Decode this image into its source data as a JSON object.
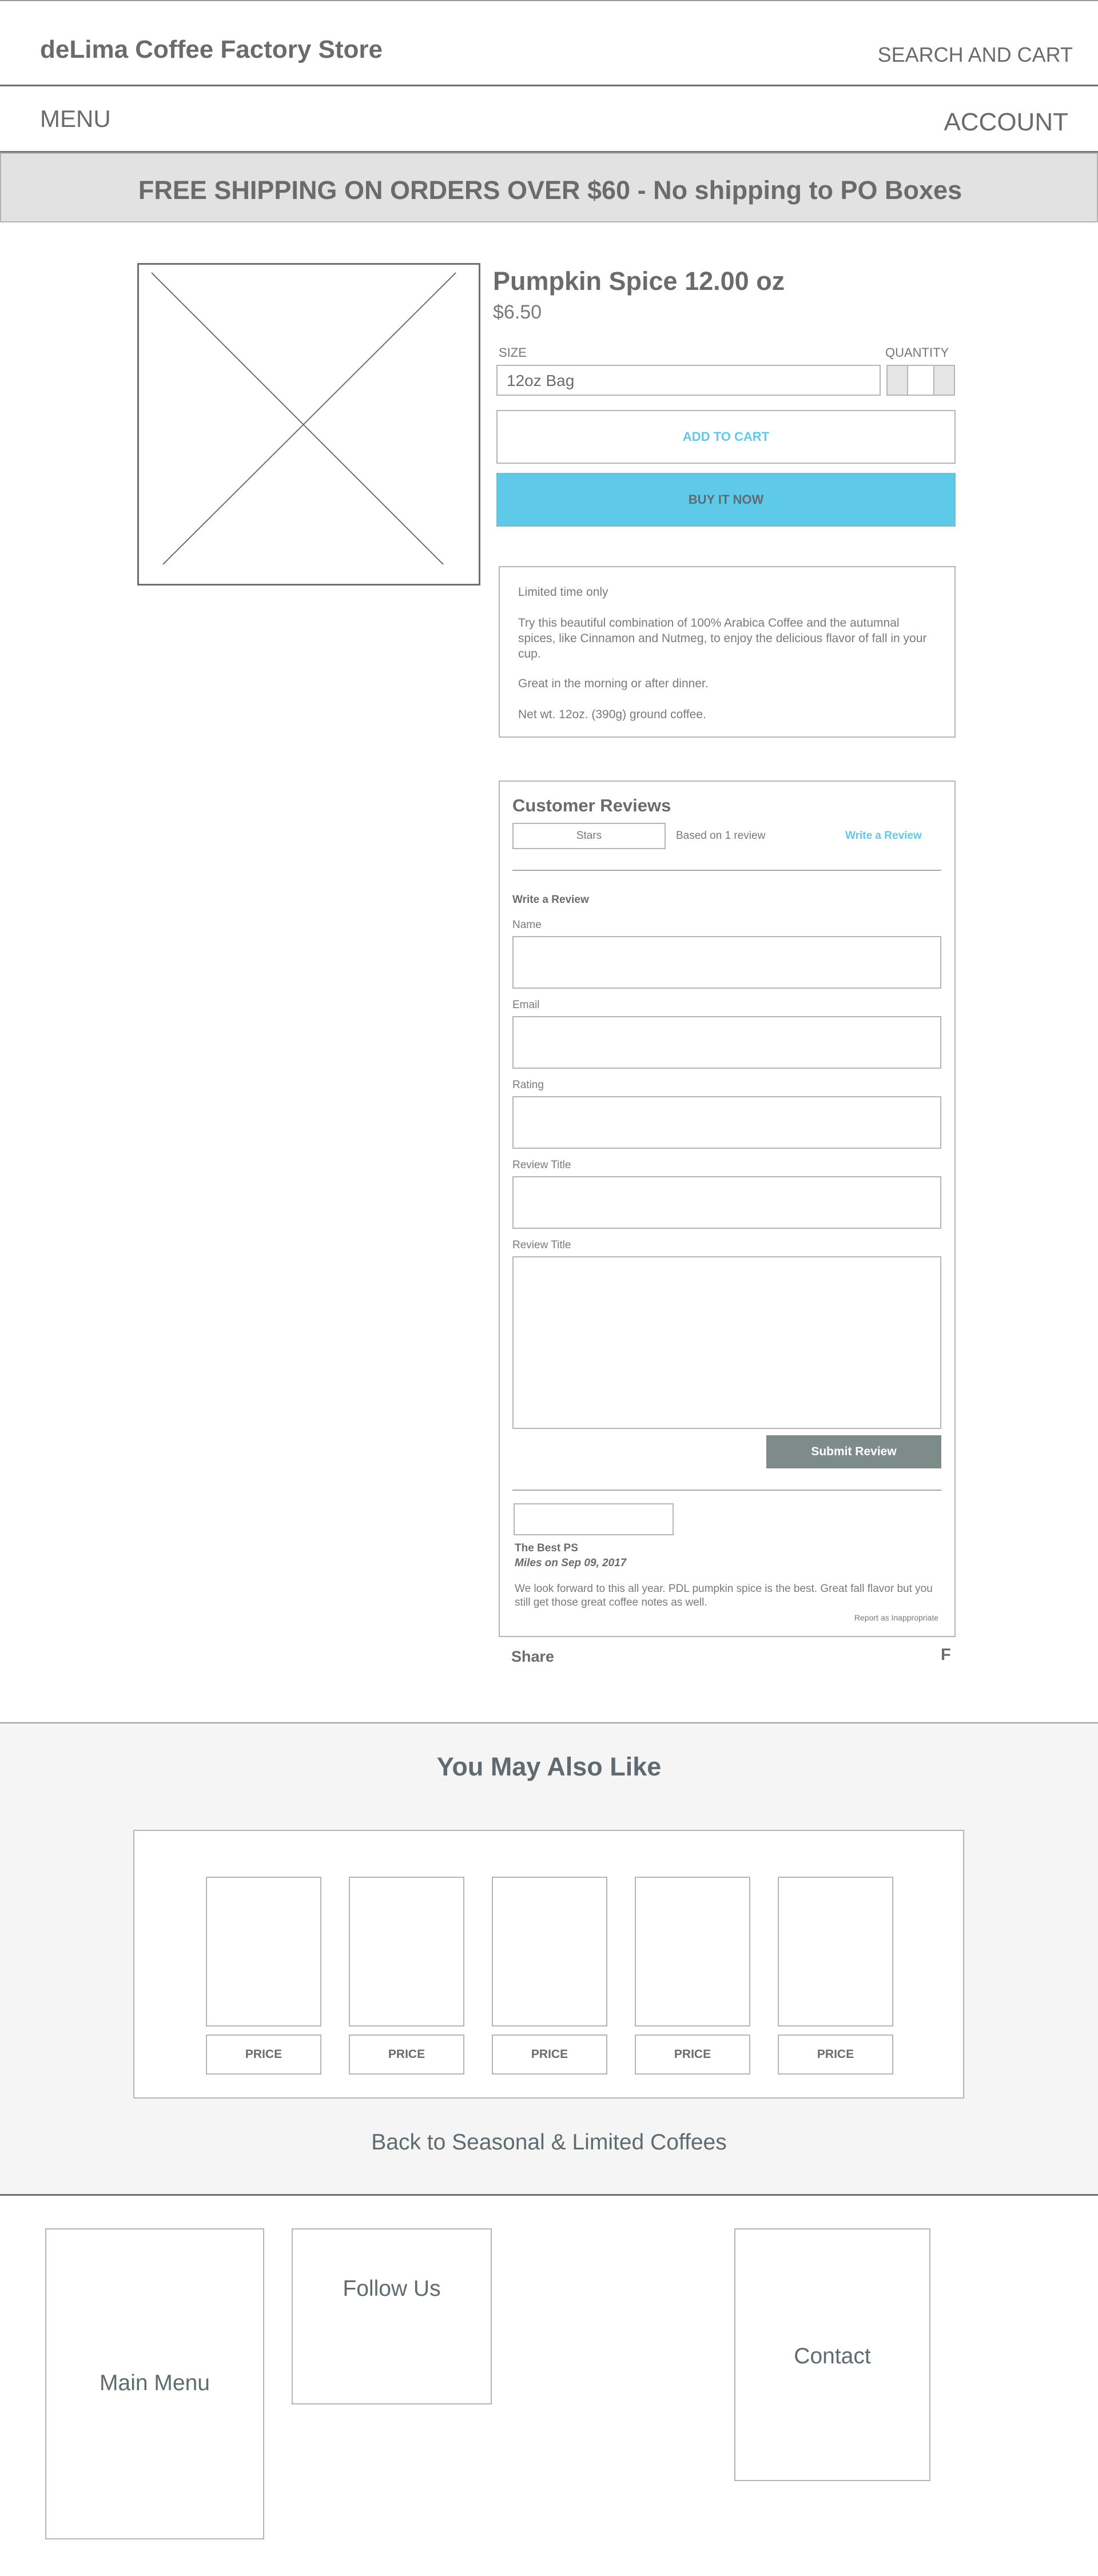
{
  "header": {
    "store_name": "deLima Coffee Factory Store",
    "search_cart": "SEARCH AND CART"
  },
  "nav": {
    "menu": "MENU",
    "account": "ACCOUNT"
  },
  "banner": {
    "text": "FREE SHIPPING ON ORDERS OVER $60 - No shipping to PO Boxes"
  },
  "product": {
    "title": "Pumpkin Spice 12.00 oz",
    "price": "$6.50",
    "size_label": "SIZE",
    "size_value": "12oz Bag",
    "quantity_label": "QUANTITY",
    "add_to_cart": "ADD TO CART",
    "buy_now": "BUY IT NOW",
    "description": [
      "Limited time only",
      "Try this beautiful combination of 100% Arabica Coffee and the autumnal spices, like Cinnamon and Nutmeg, to enjoy the delicious flavor of fall in your cup.",
      "Great in the morning or after dinner.",
      "Net wt. 12oz. (390g) ground coffee."
    ]
  },
  "reviews": {
    "title": "Customer Reviews",
    "stars_placeholder": "Stars",
    "based_on": "Based on 1 review",
    "write_review_link": "Write a Review",
    "form_title": "Write a Review",
    "fields": [
      "Name",
      "Email",
      "Rating",
      "Review Title",
      "Review Title"
    ],
    "submit": "Submit Review",
    "items": [
      {
        "title": "The Best PS",
        "author_date": "Miles on Sep 09, 2017",
        "body": "We look forward to this all year. PDL pumpkin spice is the best. Great fall flavor but you still get those great coffee notes as well.",
        "report": "Report as Inappropriate"
      }
    ]
  },
  "share": {
    "label": "Share",
    "facebook": "F"
  },
  "also_like": {
    "title": "You May Also Like",
    "items": [
      {
        "price": "PRICE"
      },
      {
        "price": "PRICE"
      },
      {
        "price": "PRICE"
      },
      {
        "price": "PRICE"
      },
      {
        "price": "PRICE"
      }
    ],
    "back_link": "Back to Seasonal & Limited Coffees"
  },
  "footer": {
    "main_menu": "Main Menu",
    "follow_us": "Follow Us",
    "contact": "Contact"
  }
}
